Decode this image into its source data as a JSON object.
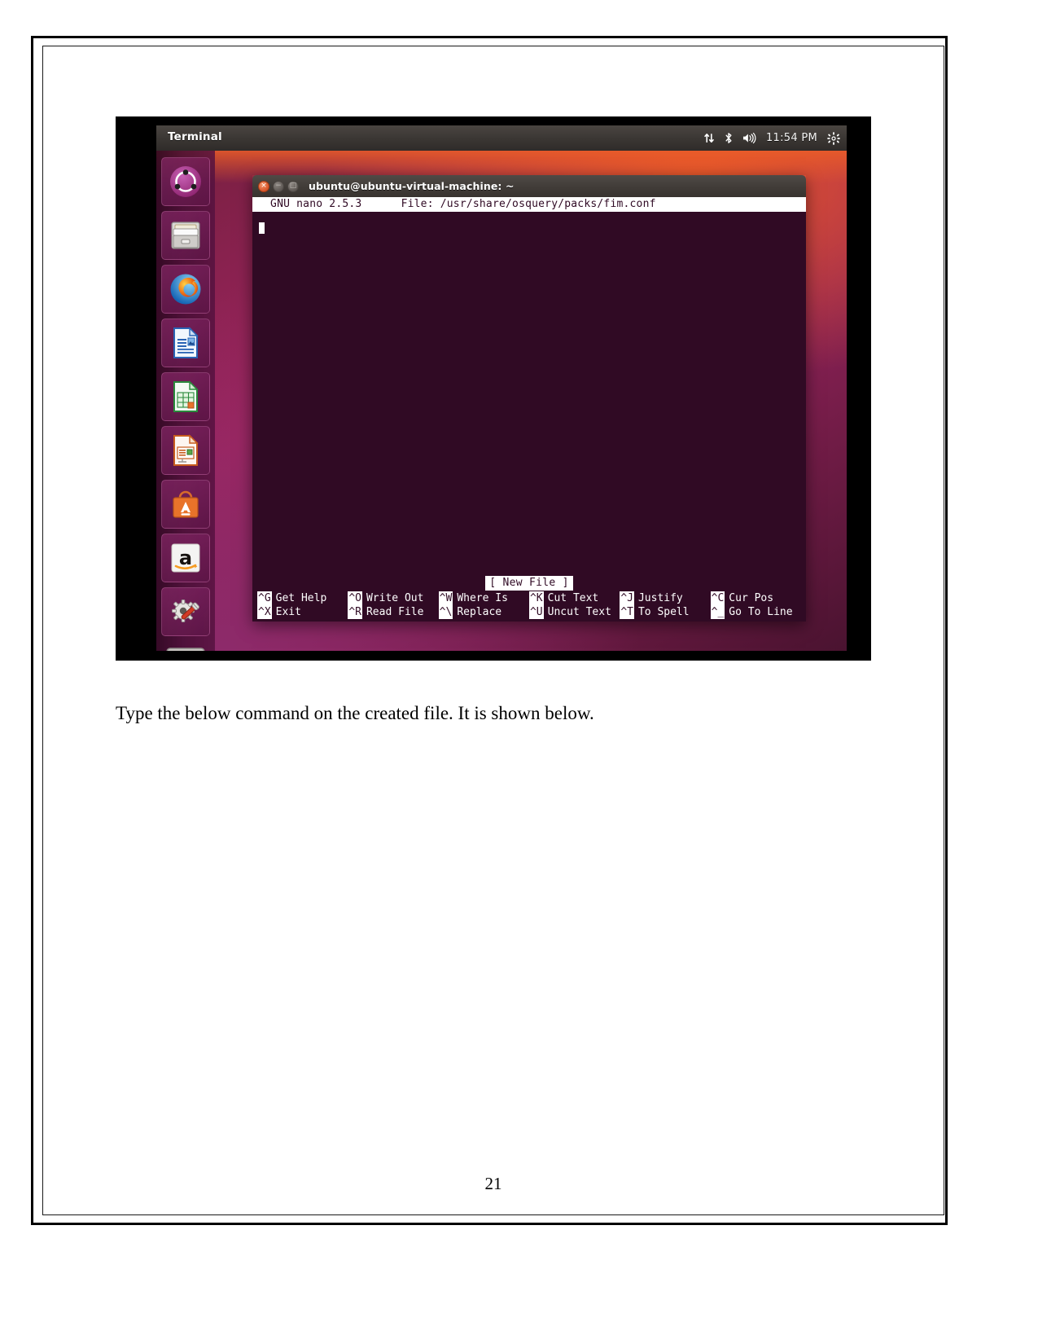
{
  "document": {
    "page_number": "21",
    "caption": "Type the below command on the created file. It is shown below."
  },
  "screenshot": {
    "top_panel": {
      "app_title": "Terminal",
      "clock": "11:54 PM",
      "tray_icons": [
        "network-icon",
        "bluetooth-icon",
        "volume-icon",
        "system-gear-icon"
      ]
    },
    "launcher": {
      "items": [
        {
          "name": "ubuntu-dash",
          "label": "Ubuntu Dash"
        },
        {
          "name": "files",
          "label": "Files"
        },
        {
          "name": "firefox",
          "label": "Firefox Web Browser"
        },
        {
          "name": "libreoffice-writer",
          "label": "LibreOffice Writer"
        },
        {
          "name": "libreoffice-calc",
          "label": "LibreOffice Calc"
        },
        {
          "name": "libreoffice-impress",
          "label": "LibreOffice Impress"
        },
        {
          "name": "ubuntu-software",
          "label": "Ubuntu Software"
        },
        {
          "name": "amazon",
          "label": "Amazon"
        },
        {
          "name": "system-settings",
          "label": "System Settings"
        },
        {
          "name": "terminal",
          "label": "Terminal"
        }
      ]
    },
    "terminal_window": {
      "title": "ubuntu@ubuntu-virtual-machine: ~",
      "close_glyph": "×",
      "minimize_glyph": "−",
      "maximize_glyph": "□"
    },
    "nano": {
      "version_label": "GNU nano 2.5.3",
      "file_label": "File: /usr/share/osquery/packs/fim.conf",
      "titlebar_text": "  GNU nano 2.5.3      File: /usr/share/osquery/packs/fim.conf",
      "status": "[ New File ]",
      "buffer_text": "",
      "shortcuts_row1": [
        {
          "key": "^G",
          "label": "Get Help"
        },
        {
          "key": "^O",
          "label": "Write Out"
        },
        {
          "key": "^W",
          "label": "Where Is"
        },
        {
          "key": "^K",
          "label": "Cut Text"
        },
        {
          "key": "^J",
          "label": "Justify"
        },
        {
          "key": "^C",
          "label": "Cur Pos"
        }
      ],
      "shortcuts_row2": [
        {
          "key": "^X",
          "label": "Exit"
        },
        {
          "key": "^R",
          "label": "Read File"
        },
        {
          "key": "^\\",
          "label": "Replace"
        },
        {
          "key": "^U",
          "label": "Uncut Text"
        },
        {
          "key": "^T",
          "label": "To Spell"
        },
        {
          "key": "^_",
          "label": "Go To Line"
        }
      ]
    },
    "colors": {
      "terminal_bg": "#300a24",
      "panel_bg": "#3a3633",
      "ubuntu_orange": "#e8572a",
      "launcher_bg": "#460e34"
    }
  }
}
